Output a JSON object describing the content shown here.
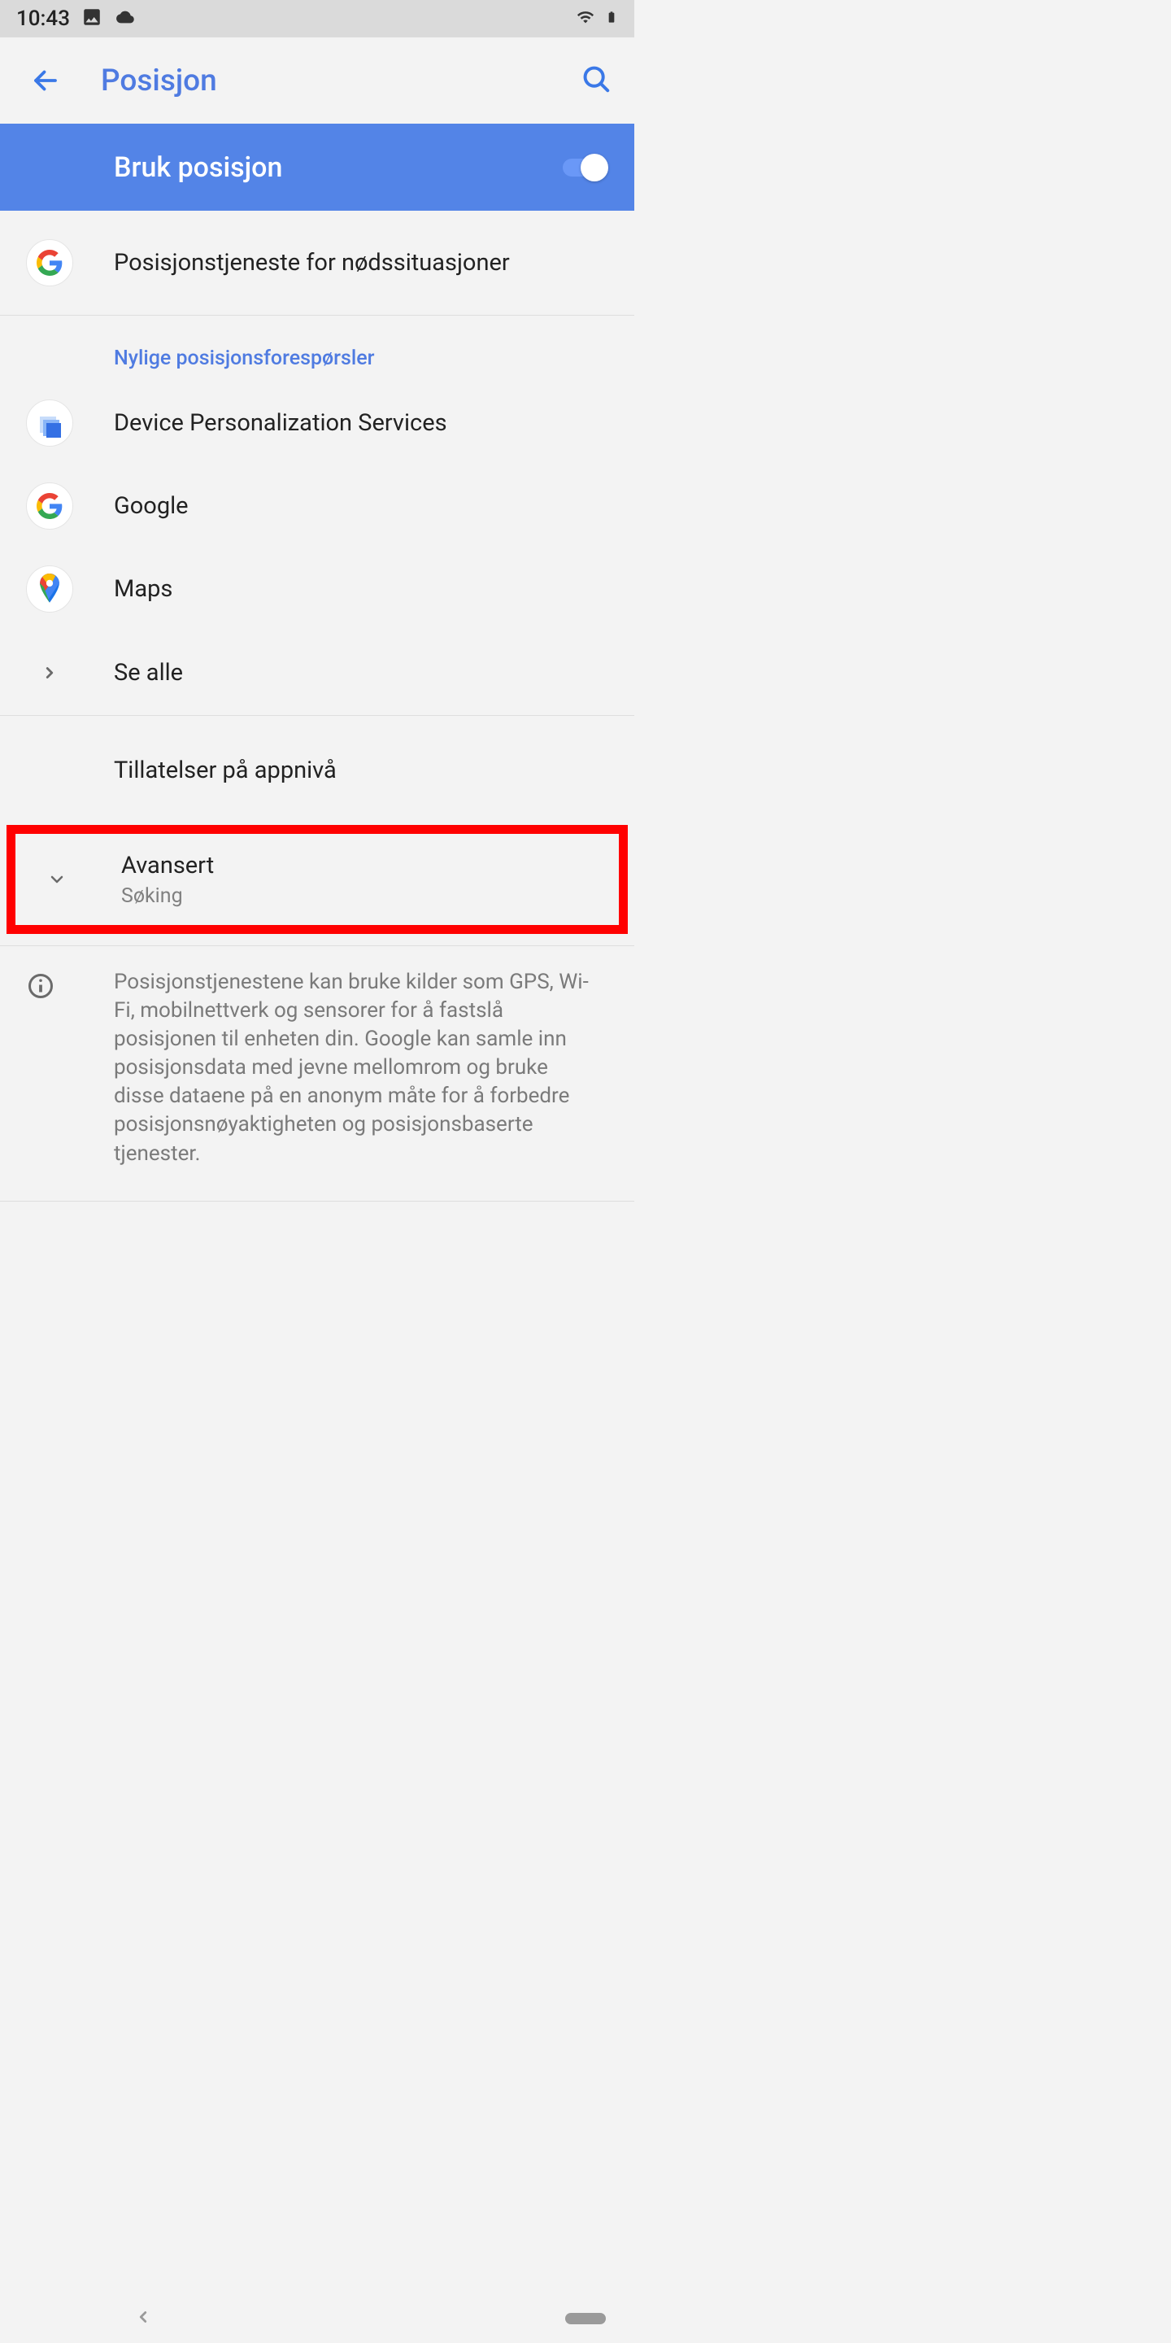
{
  "status_bar": {
    "time": "10:43"
  },
  "app_bar": {
    "title": "Posisjon"
  },
  "master_toggle": {
    "label": "Bruk posisjon",
    "on": true
  },
  "emergency_row": {
    "label": "Posisjonstjeneste for nødssituasjoner"
  },
  "recent_requests": {
    "header": "Nylige posisjonsforespørsler",
    "items": [
      {
        "label": "Device Personalization Services"
      },
      {
        "label": "Google"
      },
      {
        "label": "Maps"
      }
    ],
    "see_all": "Se alle"
  },
  "app_permissions": {
    "label": "Tillatelser på appnivå"
  },
  "advanced": {
    "title": "Avansert",
    "subtitle": "Søking"
  },
  "info_text": "Posisjonstjenestene kan bruke kilder som GPS, Wi-Fi, mobilnettverk og sensorer for å fastslå posisjonen til enheten din. Google kan samle inn posisjonsdata med jevne mellomrom og bruke disse dataene på en anonym måte for å forbedre posisjonsnøyaktigheten og posisjonsbaserte tjenester."
}
